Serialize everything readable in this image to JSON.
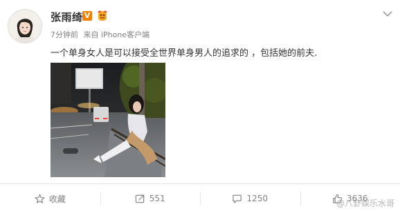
{
  "post": {
    "author": "张雨绮",
    "verified_badge": "V",
    "time": "7分钟前",
    "source": "来自 iPhone客户端",
    "text": "一个单身女人是可以接受全世界单身男人的追求的 ，包括她的前夫.",
    "photo_icon": "street-night-photo"
  },
  "actions": {
    "favorite_label": "收藏",
    "repost_count": "551",
    "comment_count": "1250",
    "like_count": "3636"
  },
  "watermark": "@八卦娱乐水哥",
  "colors": {
    "badge_orange": "#f08200",
    "meta_gray": "#808080",
    "divider": "#e6e6e6"
  }
}
